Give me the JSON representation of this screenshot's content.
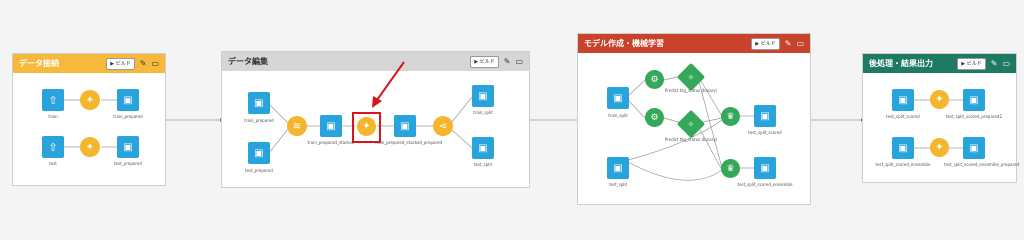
{
  "colors": {
    "panel1": "#f6b93b",
    "panel2": "#d6d6d6",
    "panel3": "#c8422c",
    "panel4": "#1f7a63",
    "dataset": "#29a3dc",
    "recipe": "#f5b52d",
    "ml": "#35a85a",
    "highlight": "#d9141b"
  },
  "panels": [
    {
      "title": "データ接続",
      "build_label": "▶ ビルド",
      "nodes": [
        {
          "label": "train",
          "icon": "upload-icon"
        },
        {
          "label": "train_prepared",
          "icon": "folder-icon"
        },
        {
          "label": "test",
          "icon": "upload-icon"
        },
        {
          "label": "test_prepared",
          "icon": "folder-icon"
        }
      ]
    },
    {
      "title": "データ編集",
      "build_label": "▶ ビルド",
      "nodes": [
        {
          "label": "train_prepared",
          "icon": "folder-icon"
        },
        {
          "label": "test_prepared",
          "icon": "folder-icon"
        },
        {
          "label": "train_prepared_stacked",
          "icon": "folder-icon"
        },
        {
          "label": "train_prepared_stacked_prepared",
          "icon": "folder-icon"
        },
        {
          "label": "train_split",
          "icon": "folder-icon"
        },
        {
          "label": "test_split",
          "icon": "folder-icon"
        }
      ]
    },
    {
      "title": "モデル作成・機械学習",
      "build_label": "▶ ビルド",
      "nodes": [
        {
          "label": "train_split",
          "icon": "folder-icon"
        },
        {
          "label": "test_split",
          "icon": "folder-icon"
        },
        {
          "label": "Predict hlg_status (binary)",
          "icon": "model-icon"
        },
        {
          "label": "Predict hlg_status (binary)",
          "icon": "model-icon"
        },
        {
          "label": "test_split_scored",
          "icon": "folder-icon"
        },
        {
          "label": "test_split_scored_ensemble",
          "icon": "folder-icon"
        }
      ]
    },
    {
      "title": "後処理・結果出力",
      "build_label": "▶ ビルド",
      "nodes": [
        {
          "label": "test_split_scored",
          "icon": "folder-icon"
        },
        {
          "label": "test_split_scored_prepared2",
          "icon": "folder-icon"
        },
        {
          "label": "test_split_scored_ensemble",
          "icon": "folder-icon"
        },
        {
          "label": "test_split_scored_ensemble_prepared",
          "icon": "folder-icon"
        }
      ]
    }
  ]
}
